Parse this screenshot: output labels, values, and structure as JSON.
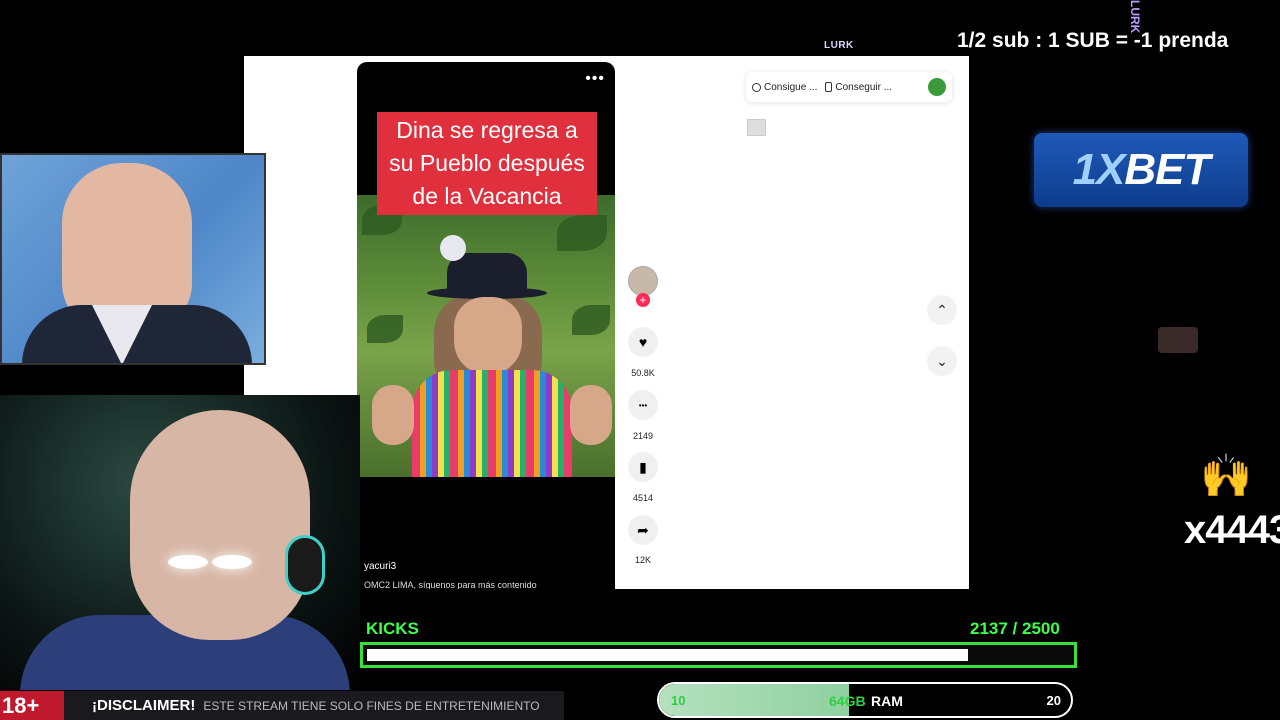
{
  "overlay": {
    "sub_text": "1/2 sub  : 1 SUB = -1 prenda",
    "lurk": "LURK",
    "lurk_vertical": "LURK",
    "bet_logo_a": "1X",
    "bet_logo_b": "BET",
    "right_text": "x4443",
    "hands_emoji": "🙌",
    "age_badge": "18+",
    "disclaimer_title": "¡DISCLAIMER!",
    "disclaimer_text": "ESTE STREAM TIENE SOLO FINES DE ENTRETENIMIENTO"
  },
  "kicks": {
    "label": "KICKS",
    "current": 2137,
    "goal": 2500,
    "count_text": "2137  / 2500"
  },
  "ram": {
    "min": "10",
    "mid": "64GB",
    "label": "RAM",
    "max": "20",
    "progress_fraction": 0.46
  },
  "video": {
    "menu_icon": "•••",
    "caption": "Dina se regresa a su Pueblo  después de la Vacancia",
    "username": "yacuri3",
    "description": "OMC2 LIMA, síguenos para más contenido"
  },
  "actions": {
    "follow_plus": "+",
    "like_icon": "heart-icon",
    "like_glyph": "♥",
    "like_count": "50.8K",
    "comment_icon": "comment-icon",
    "comment_glyph": "•••",
    "comment_count": "2149",
    "save_icon": "bookmark-icon",
    "save_glyph": "▮",
    "save_count": "4514",
    "share_icon": "share-icon",
    "share_glyph": "➦",
    "share_count": "12K"
  },
  "topbar": {
    "pill1": "Consigue ...",
    "pill2": "Conseguir ..."
  },
  "nav": {
    "up": "⌃",
    "down": "⌄"
  },
  "colors": {
    "accent_green": "#3dff4a",
    "caption_red": "#e1303d",
    "bet_blue": "#1f5ab8",
    "age_red": "#c0182d"
  }
}
